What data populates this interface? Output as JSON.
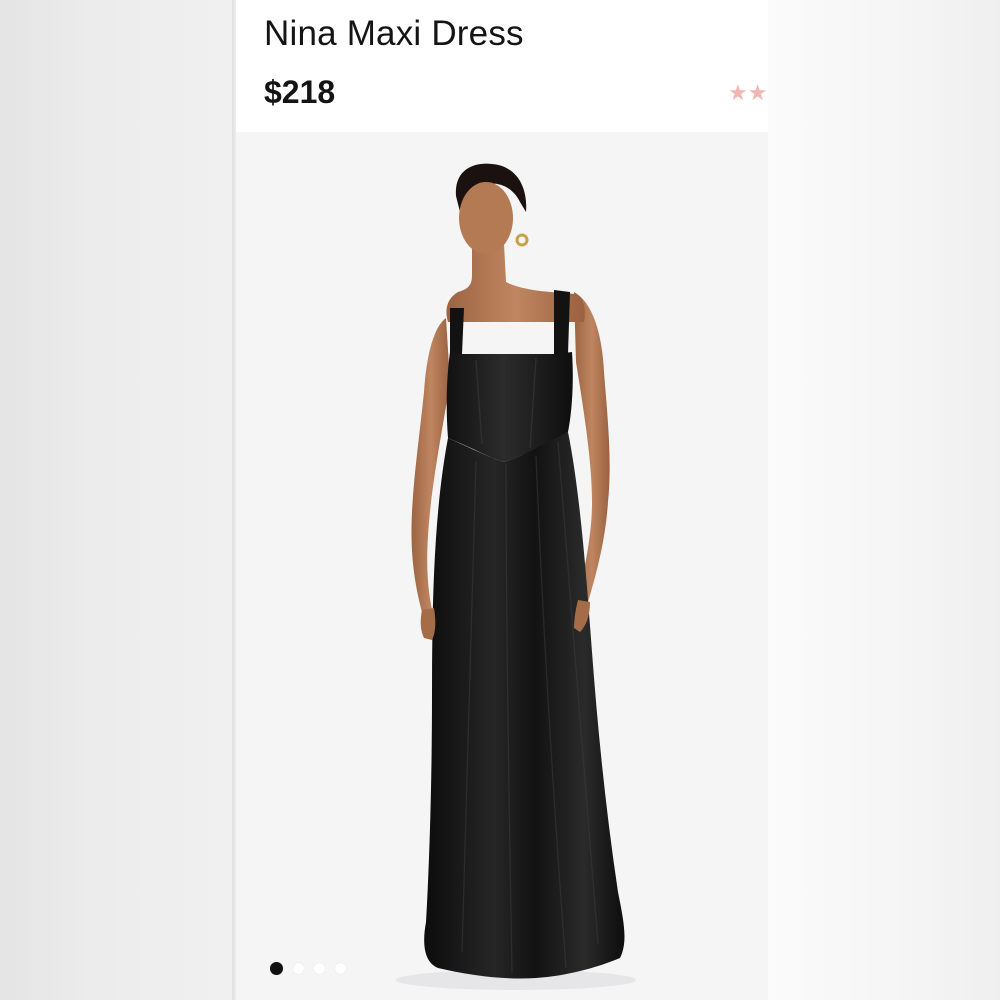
{
  "product": {
    "title": "Nina Maxi Dress",
    "price": "$218",
    "rating_icon": "star-icon",
    "rating_color": "#f0b6b4"
  },
  "gallery": {
    "image_alt": "Model wearing black satin maxi dress",
    "slide_count": 4,
    "active_slide": 1
  },
  "colors": {
    "dress": "#141414",
    "skin": "#b67d57",
    "background": "#f5f5f6"
  }
}
